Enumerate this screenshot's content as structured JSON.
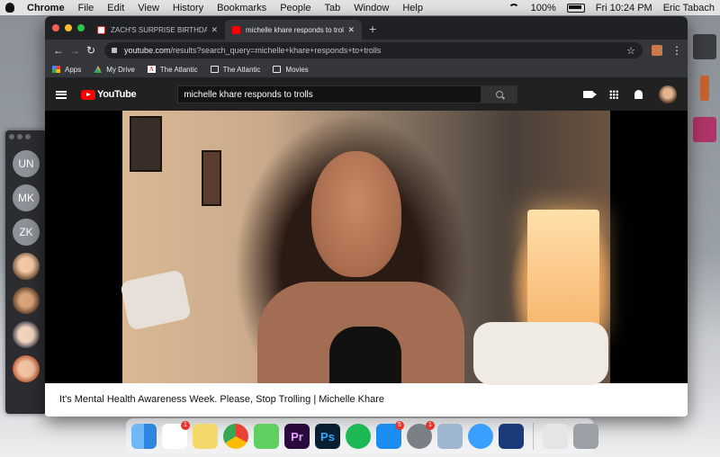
{
  "menubar": {
    "app": "Chrome",
    "items": [
      "File",
      "Edit",
      "View",
      "History",
      "Bookmarks",
      "People",
      "Tab",
      "Window",
      "Help"
    ],
    "battery": "100%",
    "clock": "Fri 10:24 PM",
    "user": "Eric Tabach"
  },
  "contacts": {
    "initials": [
      "UN",
      "MK",
      "ZK"
    ]
  },
  "browser": {
    "tabs": [
      {
        "title": "ZACH'S SURPRISE BIRTHDAY",
        "favicon": "gmail-icon"
      },
      {
        "title": "michelle khare responds to trolls",
        "favicon": "youtube-icon"
      }
    ],
    "new_tab": "+",
    "url_host": "youtube.com",
    "url_path": "/results?search_query=michelle+khare+responds+to+trolls",
    "bookmarks": [
      {
        "label": "Apps",
        "icon": "apps-icon"
      },
      {
        "label": "My Drive",
        "icon": "drive-icon"
      },
      {
        "label": "The Atlantic",
        "icon": "atlantic-icon"
      },
      {
        "label": "The Atlantic",
        "icon": "folder-icon"
      },
      {
        "label": "Movies",
        "icon": "folder-icon"
      }
    ]
  },
  "youtube": {
    "logo_text": "YouTube",
    "search_value": "michelle khare responds to trolls",
    "video_title": "It's Mental Health Awareness Week. Please, Stop Trolling  |  Michelle Khare"
  },
  "dock": {
    "badges": {
      "slack": "1",
      "appstore": "5",
      "sysprefs": "1"
    },
    "ps_label": "Ps",
    "pr_label": "Pr"
  },
  "colors": {
    "chrome_dark": "#202124",
    "youtube_red": "#ff0000",
    "youtube_header": "#212121"
  }
}
